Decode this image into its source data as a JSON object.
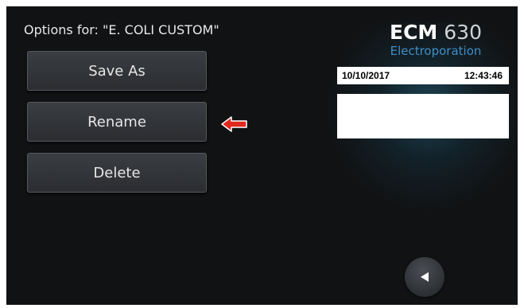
{
  "screen": {
    "options_title": "Options for: \"E. COLI CUSTOM\"",
    "buttons": {
      "save_as": "Save As",
      "rename": "Rename",
      "delete": "Delete"
    },
    "brand": {
      "model_bold": "ECM",
      "model_number": "630",
      "subtitle": "Electroporation"
    },
    "status": {
      "date": "10/10/2017",
      "time": "12:43:46"
    },
    "colors": {
      "background": "#111213",
      "accent_blue": "#3e8fc7",
      "arrow_red": "#e0281e"
    },
    "icons": {
      "pointer": "left-arrow-icon",
      "back": "triangle-left-icon"
    }
  }
}
